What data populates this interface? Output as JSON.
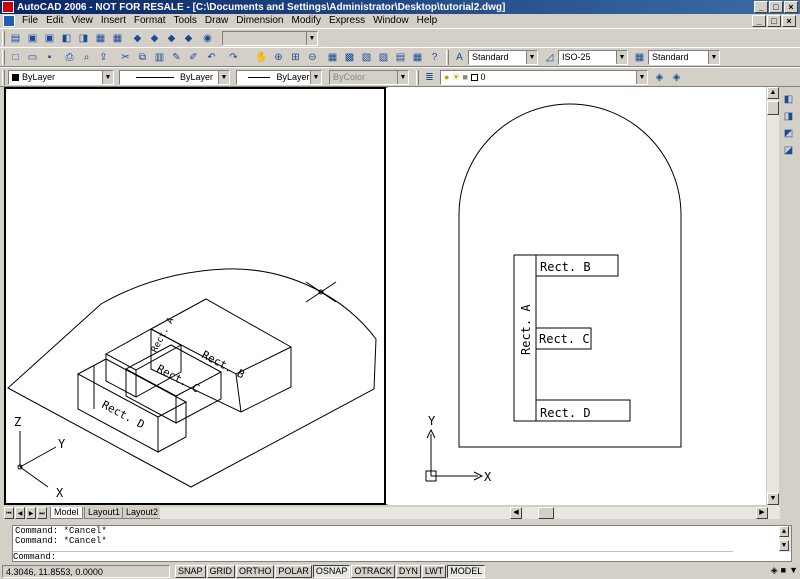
{
  "window": {
    "title": "AutoCAD 2006 - NOT FOR RESALE - [C:\\Documents and Settings\\Administrator\\Desktop\\tutorial2.dwg]",
    "minimize": "_",
    "maximize": "□",
    "close": "×"
  },
  "menu": [
    "File",
    "Edit",
    "View",
    "Insert",
    "Format",
    "Tools",
    "Draw",
    "Dimension",
    "Modify",
    "Express",
    "Window",
    "Help"
  ],
  "styles": {
    "text_style": "Standard",
    "dim_style": "ISO-25",
    "table_style": "Standard"
  },
  "properties": {
    "color": "ByLayer",
    "linetype": "ByLayer",
    "lineweight": "ByLayer",
    "plotstyle": "ByColor",
    "layer": "0"
  },
  "drawing_labels": {
    "rect_a": "Rect. A",
    "rect_b": "Rect. B",
    "rect_c": "Rect. C",
    "rect_d": "Rect. D",
    "axis_x": "X",
    "axis_y": "Y",
    "axis_z": "Z"
  },
  "tabs": [
    "Model",
    "Layout1",
    "Layout2"
  ],
  "active_tab": "Model",
  "command_history": [
    "Command: *Cancel*",
    "Command: *Cancel*"
  ],
  "command_prompt": "Command:",
  "status": {
    "coordinates": "4.3046, 11.8553, 0.0000",
    "toggles": [
      "SNAP",
      "GRID",
      "ORTHO",
      "POLAR",
      "OSNAP",
      "OTRACK",
      "DYN",
      "LWT",
      "MODEL"
    ],
    "active_toggles": [
      "OSNAP",
      "MODEL"
    ]
  }
}
